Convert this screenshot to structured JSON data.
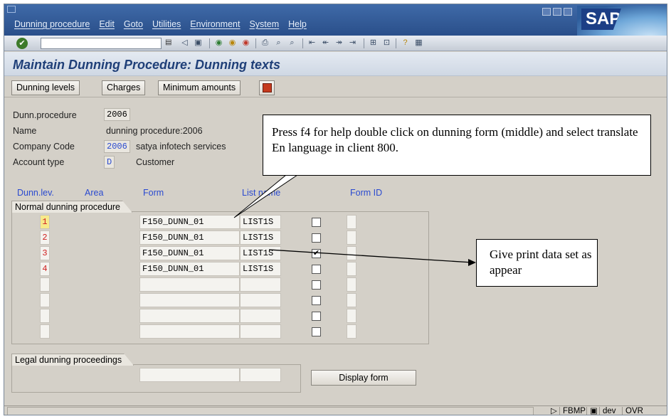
{
  "menubar": {
    "items": [
      "Dunning procedure",
      "Edit",
      "Goto",
      "Utilities",
      "Environment",
      "System",
      "Help"
    ],
    "logo": "SAP"
  },
  "toolbar": {
    "command_field_value": "",
    "icons": [
      "enter-icon",
      "back-icon",
      "exit-icon",
      "cancel-icon",
      "print-icon",
      "find-icon",
      "find-next-icon",
      "first-page-icon",
      "previous-page-icon",
      "next-page-icon",
      "last-page-icon",
      "create-session-icon",
      "shortcut-icon",
      "help-icon",
      "layout-icon"
    ]
  },
  "page_title": "Maintain Dunning Procedure: Dunning texts",
  "app_toolbar": {
    "buttons": [
      "Dunning levels",
      "Charges",
      "Minimum amounts"
    ]
  },
  "header_fields": {
    "dunn_procedure": {
      "label": "Dunn.procedure",
      "value": "2006"
    },
    "name": {
      "label": "Name",
      "value": "dunning procedure:2006"
    },
    "company_code": {
      "label": "Company Code",
      "value": "2006",
      "text": "satya infotech  services"
    },
    "account_type": {
      "label": "Account type",
      "value": "D",
      "text": "Customer"
    }
  },
  "columns": {
    "dunn_lev": "Dunn.lev.",
    "area": "Area",
    "form": "Form",
    "list_name": "List name",
    "form_id": "Form ID"
  },
  "normal_group_title": "Normal dunning procedure",
  "rows": [
    {
      "level": "1",
      "form": "F150_DUNN_01",
      "list": "LIST1S",
      "checked": false
    },
    {
      "level": "2",
      "form": "F150_DUNN_01",
      "list": "LIST1S",
      "checked": false
    },
    {
      "level": "3",
      "form": "F150_DUNN_01",
      "list": "LIST1S",
      "checked": true
    },
    {
      "level": "4",
      "form": "F150_DUNN_01",
      "list": "LIST1S",
      "checked": false
    },
    {
      "level": "",
      "form": "",
      "list": "",
      "checked": false
    },
    {
      "level": "",
      "form": "",
      "list": "",
      "checked": false
    },
    {
      "level": "",
      "form": "",
      "list": "",
      "checked": false
    },
    {
      "level": "",
      "form": "",
      "list": "",
      "checked": false
    }
  ],
  "legal_group_title": "Legal dunning proceedings",
  "display_form_button": "Display form",
  "callouts": {
    "top": "Press f4 for help double click on dunning form (middle) and select translate En language in client 800.",
    "right": "Give print data set as appear"
  },
  "statusbar": {
    "transaction": "FBMP",
    "system": "dev",
    "mode": "OVR"
  }
}
